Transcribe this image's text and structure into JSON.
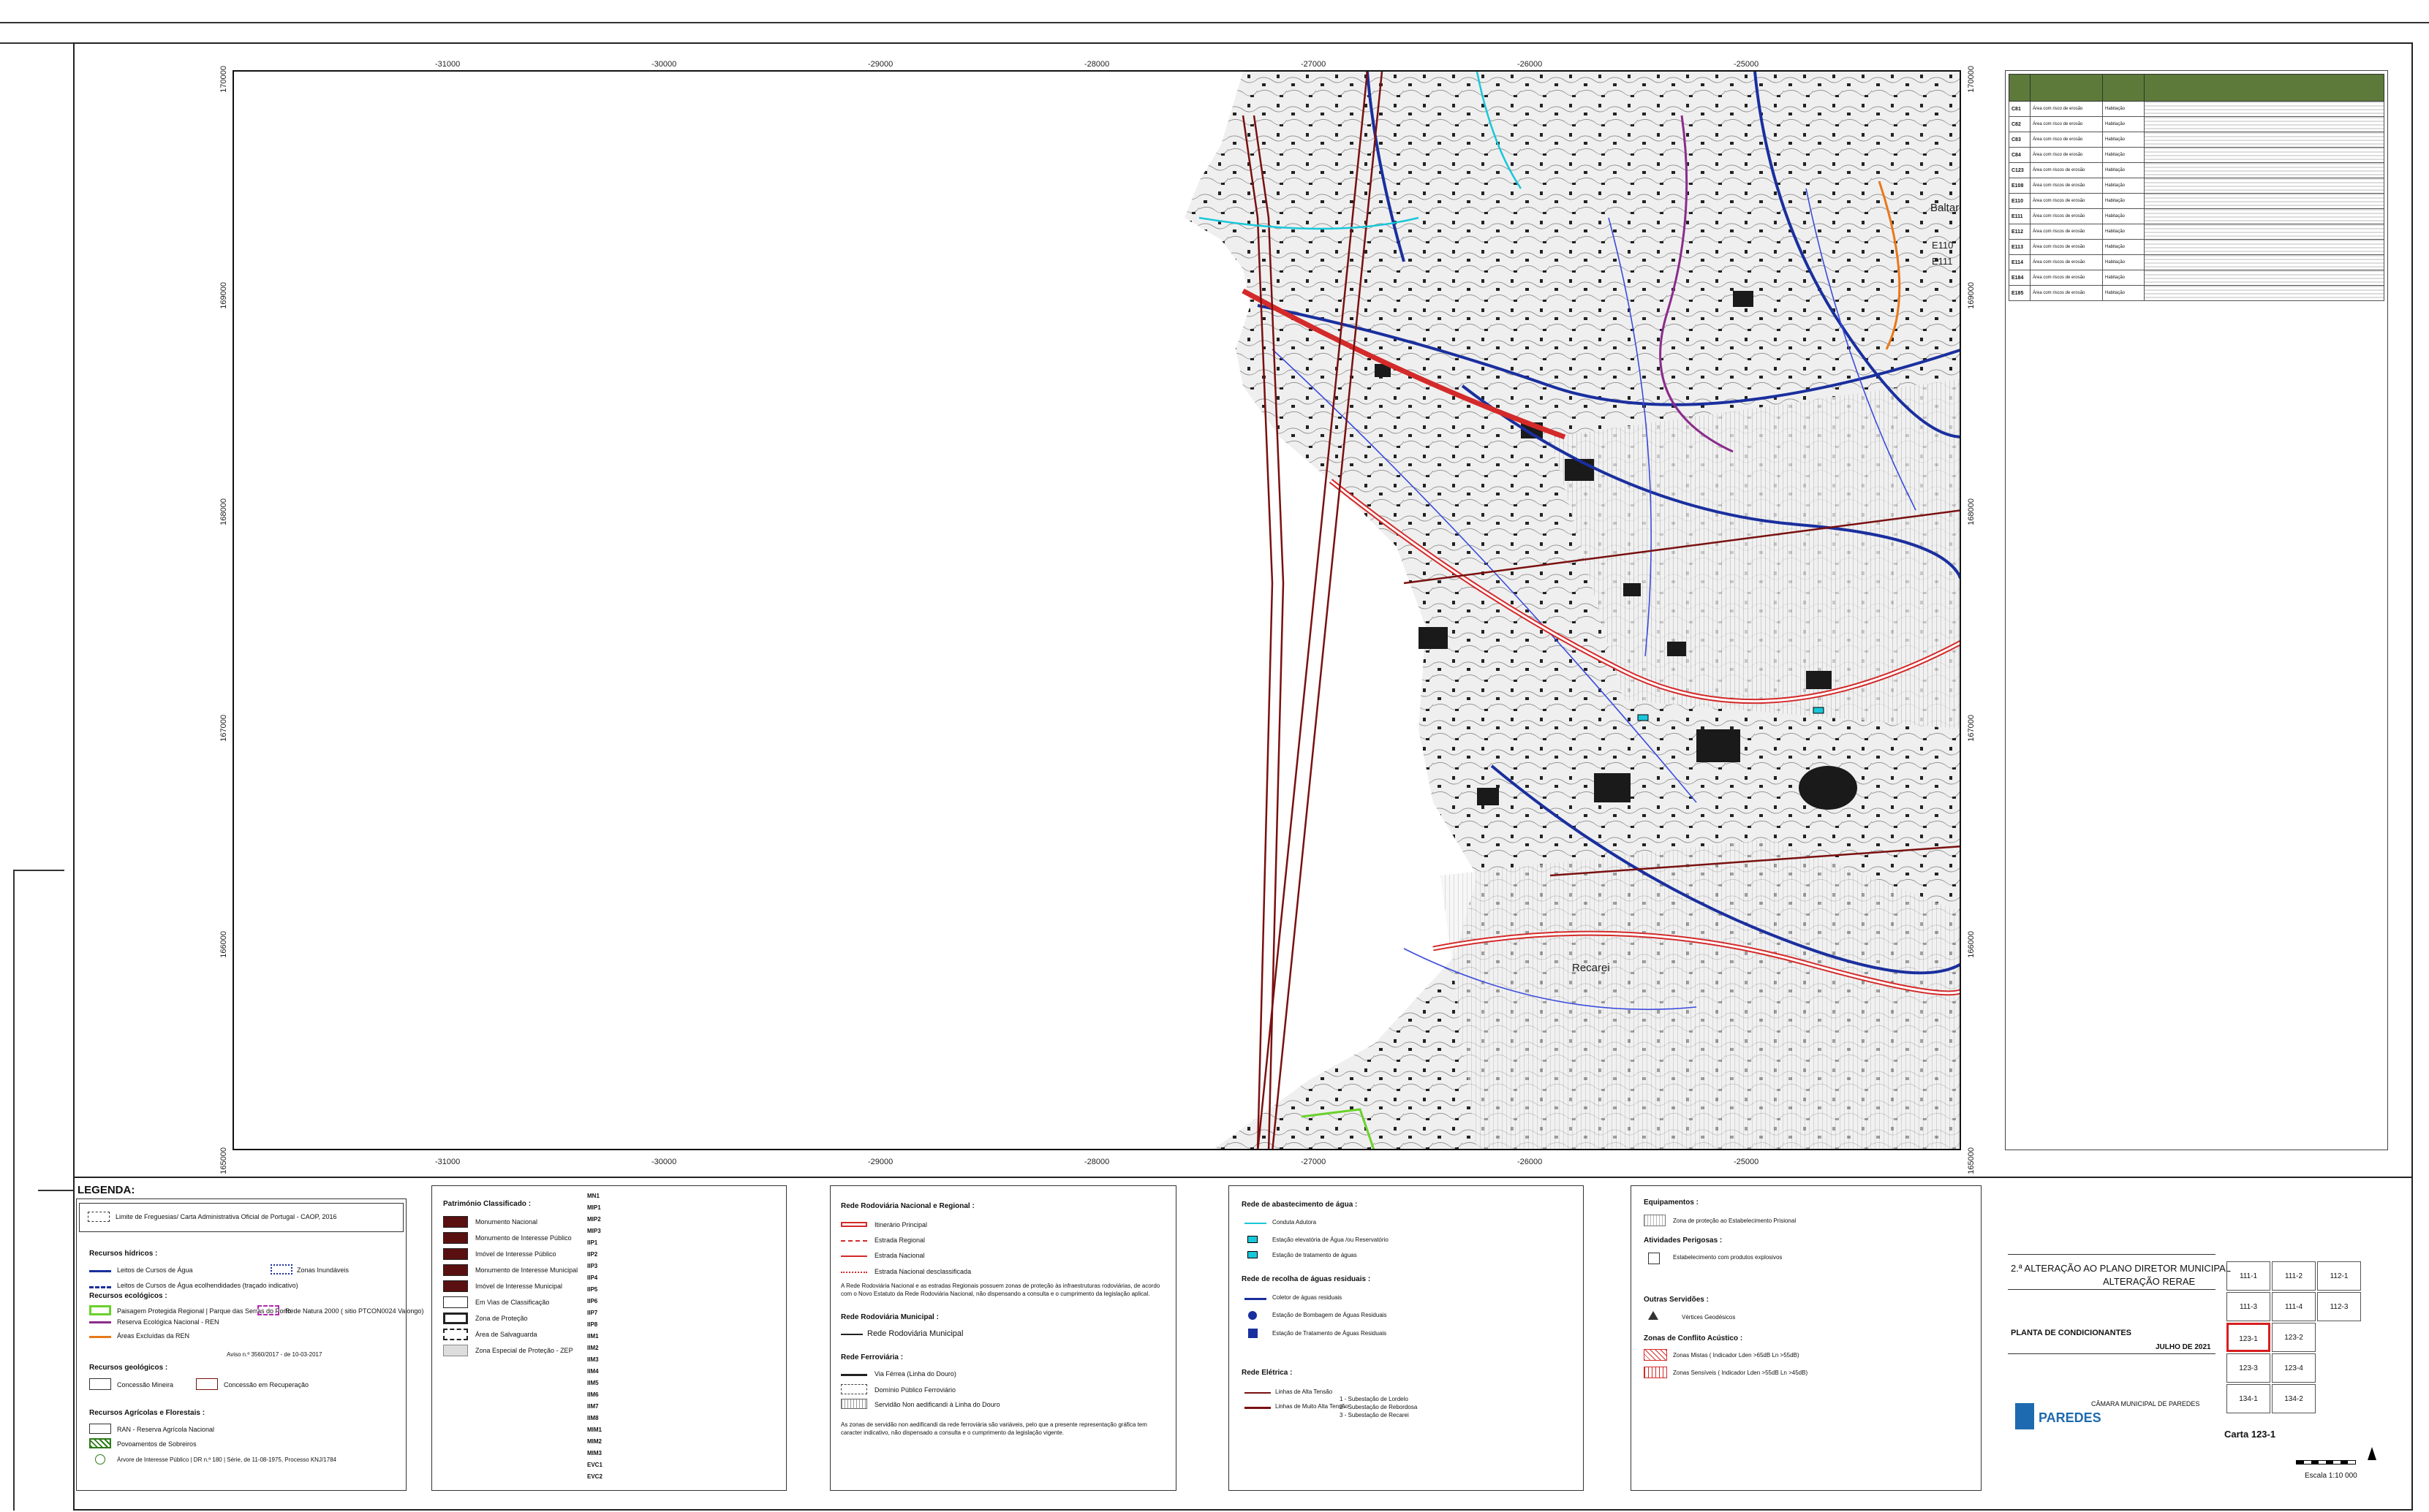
{
  "map": {
    "x_ticks": [
      "-31000",
      "-30000",
      "-29000",
      "-28000",
      "-27000",
      "-26000",
      "-25000"
    ],
    "y_ticks": [
      "170000",
      "169000",
      "168000",
      "167000",
      "166000",
      "165000"
    ],
    "places": [
      "Baltar",
      "E110",
      "E111",
      "Recarei"
    ],
    "colors": {
      "road_red": "#d42a2a",
      "river_blue": "#1a2f9e",
      "boundary_purple": "#8b2c8b",
      "water_cyan": "#19c7d9",
      "orange": "#e8781a",
      "rail_dark": "#7a1010"
    }
  },
  "table": {
    "rows": [
      {
        "id": "C81",
        "cls": "Área com risco de erosão",
        "tp": "Habitação"
      },
      {
        "id": "C82",
        "cls": "Área com risco de erosão",
        "tp": "Habitação"
      },
      {
        "id": "C83",
        "cls": "Área com risco de erosão",
        "tp": "Habitação"
      },
      {
        "id": "C84",
        "cls": "Área com risco de erosão",
        "tp": "Habitação"
      },
      {
        "id": "C123",
        "cls": "Área com riscos de erosão",
        "tp": "Habitação"
      },
      {
        "id": "E108",
        "cls": "Área com riscos de erosão",
        "tp": "Habitação"
      },
      {
        "id": "E110",
        "cls": "Área com riscos de erosão",
        "tp": "Habitação"
      },
      {
        "id": "E111",
        "cls": "Área com riscos de erosão",
        "tp": "Habitação"
      },
      {
        "id": "E112",
        "cls": "Área com riscos de erosão",
        "tp": "Habitação"
      },
      {
        "id": "E113",
        "cls": "Área com riscos de erosão",
        "tp": "Habitação"
      },
      {
        "id": "E114",
        "cls": "Área com riscos de erosão",
        "tp": "Habitação"
      },
      {
        "id": "E184",
        "cls": "Área com riscos de erosão",
        "tp": "Habitação"
      },
      {
        "id": "E185",
        "cls": "Área com riscos de erosão",
        "tp": "Habitação"
      }
    ]
  },
  "legend": {
    "title": "LEGENDA:",
    "limite": "Limite de Freguesias/ Carta Administrativa Oficial de Portugal - CAOP, 2016",
    "hidricos_title": "Recursos hídricos :",
    "hidricos": [
      "Leitos de Cursos de Água",
      "Leitos de Cursos de Água ecolhendidades (traçado indicativo)",
      "Zonas Inundáveis"
    ],
    "ecologicos_title": "Recursos ecológicos :",
    "ecologicos": [
      "Paisagem Protegida Regional | Parque das Serras do Porto",
      "Rede Natura 2000 ( sitio PTCON0024 Valongo)",
      "Reserva Ecológica Nacional - REN",
      "Áreas Excluídas da REN"
    ],
    "aviso": "Aviso n.º 3560/2017 - de 10-03-2017",
    "geologicos_title": "Recursos geológicos :",
    "geologicos": [
      "Concessão Mineira",
      "Concessão em Recuperação"
    ],
    "agricolas_title": "Recursos Agrícolas e Florestais :",
    "agricolas": [
      "RAN - Reserva Agrícola Nacional",
      "Povoamentos de Sobreiros",
      "Árvore de Interesse Público | DR n.º 180 | Série, de 11-08-1975, Processo KNJ/1784"
    ],
    "patrimonio_title": "Património Classificado :",
    "patrimonio": [
      "Monumento Nacional",
      "Monumento de Interesse Público",
      "Imóvel de Interesse Público",
      "Monumento de Interesse Municipal",
      "Imóvel de Interesse Municipal",
      "Em Vias de Classificação",
      "Zona de Proteção",
      "Área de Salvaguarda",
      "Zona Especial de Proteção - ZEP"
    ],
    "patrimonio_codes": [
      "MN1",
      "MIP1",
      "MIP2",
      "MIP3",
      "IIP1",
      "IIP2",
      "IIP3",
      "IIP4",
      "IIP5",
      "IIP6",
      "IIP7",
      "IIP8",
      "IIM1",
      "IIM2",
      "IIM3",
      "IIM4",
      "IIM5",
      "IIM6",
      "IIM7",
      "IIM8",
      "MIM1",
      "MIM2",
      "MIM3",
      "EVC1",
      "EVC2"
    ],
    "rodoviaria_title": "Rede Rodoviária Nacional e Regional :",
    "rodoviaria": [
      "Itinerário Principal",
      "Estrada Regional",
      "Estrada Nacional",
      "Estrada Nacional desclassificada"
    ],
    "rodoviaria_note": "A Rede Rodoviária Nacional e as estradas Regionais possuem zonas de proteção às infraestruturas rodoviárias, de acordo com o Novo Estatuto da Rede Rodoviária Nacional, não dispensando a consulta e o cumprimento da legislação aplical.",
    "municipal_title": "Rede Rodoviária Municipal :",
    "municipal": "Rede Rodoviária Municipal",
    "ferroviaria_title": "Rede Ferroviária :",
    "ferroviaria": [
      "Via Férrea (Linha do Douro)",
      "Domínio Público Ferroviário",
      "Servidão Non aedificandi à Linha do Douro"
    ],
    "ferroviaria_note": "As zonas de servidão non aedificandi da rede ferroviária são variáveis, pelo que  a presente representação gráfica  tem caracter indicativo,  não dispensado a consulta e o cumprimento da legislação vigente.",
    "agua_title": "Rede de abastecimento de água :",
    "agua": [
      "Conduta Adutora",
      "Estação elevatória de Água /ou Reservatório",
      "Estação de tratamento de águas"
    ],
    "residuais_title": "Rede de recolha de águas residuais :",
    "residuais": [
      "Coletor de águas residuais",
      "Estação de Bombagem de Águas Residuais",
      "Estação de Tratamento de Águas Residuais"
    ],
    "eletrica_title": "Rede Elétrica :",
    "eletrica": [
      "Linhas de Alta Tensão",
      "Linhas de Muito Alta Tensão"
    ],
    "subestacoes": [
      "1 - Subestação de Lordelo",
      "2 - Subestação de Rebordosa",
      "3 - Subestação de Recarei"
    ],
    "equipamentos_title": "Equipamentos :",
    "equipamentos": "Zona de proteção ao Estabelecimento Prisional",
    "perigosas_title": "Atividades Perigosas :",
    "perigosas": "Estabelecimento com produtos explosivos",
    "outras_title": "Outras Servidões :",
    "outras": "Vértices Geodésicos",
    "ruido_title": "Zonas de Conflito Acústico :",
    "ruido": [
      "Zonas Mistas ( Indicador Lden >65dB Ln >55dB)",
      "Zonas Sensíveis ( Indicador Lden >55dB Ln >45dB)"
    ]
  },
  "title_block": {
    "line1": "2.ª ALTERAÇÃO AO PLANO DIRETOR MUNICIPAL",
    "line2": "ALTERAÇÃO RERAE",
    "plan": "PLANTA DE CONDICIONANTES",
    "date": "JULHO DE 2021",
    "municipality": "CÂMARA MUNICIPAL DE PAREDES",
    "logo_text": "PAREDES",
    "carta": "Carta 123-1",
    "escala": "Escala  1:10 000",
    "index": [
      "111-1",
      "111-2",
      "112-1",
      "111-3",
      "111-4",
      "112-3",
      "123-1",
      "123-2",
      "123-3",
      "123-4",
      "134-1",
      "134-2"
    ],
    "selected": "123-1",
    "accent": "#d61f1f"
  }
}
